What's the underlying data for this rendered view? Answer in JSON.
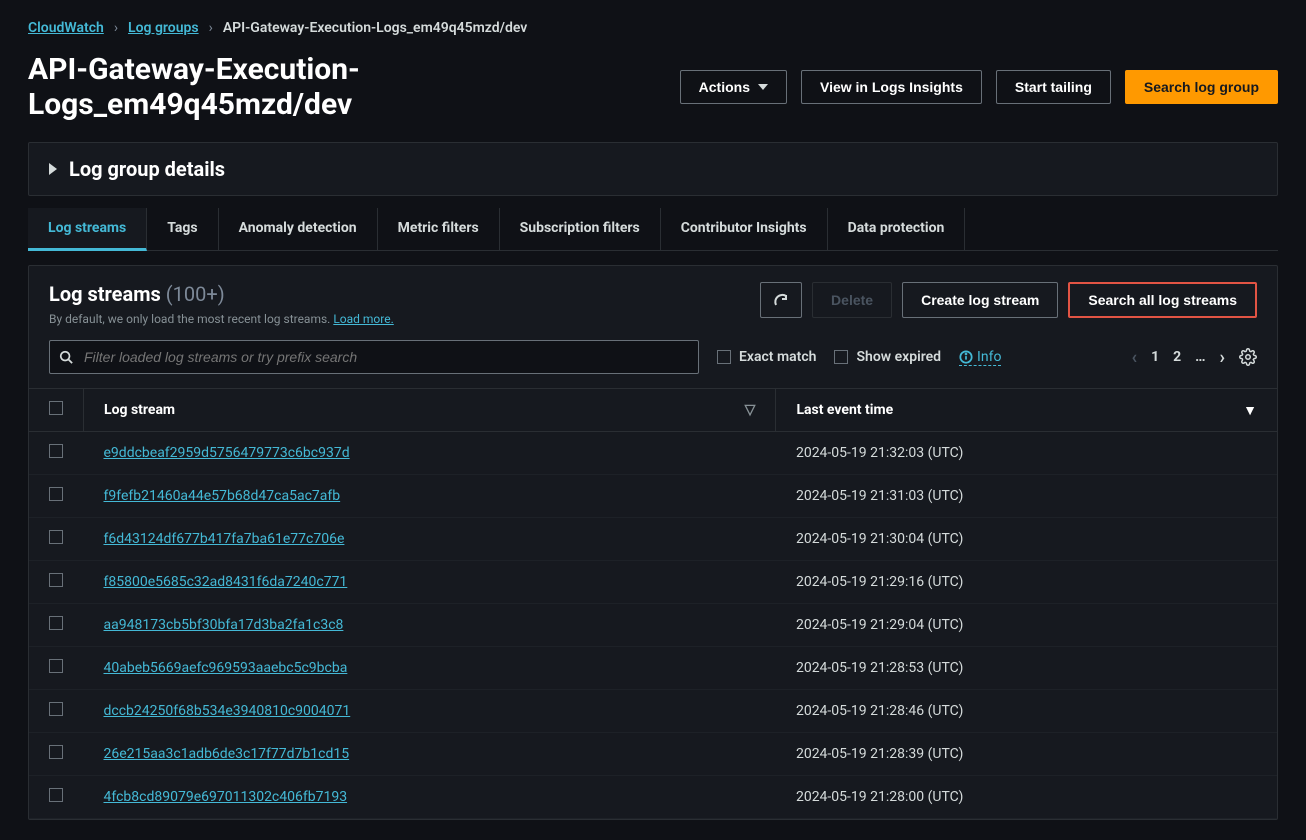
{
  "breadcrumb": {
    "root": "CloudWatch",
    "parent": "Log groups",
    "current": "API-Gateway-Execution-Logs_em49q45mzd/dev"
  },
  "header": {
    "title": "API-Gateway-Execution-Logs_em49q45mzd/dev",
    "actions": "Actions",
    "view_insights": "View in Logs Insights",
    "start_tailing": "Start tailing",
    "search_group": "Search log group"
  },
  "details": {
    "title": "Log group details"
  },
  "tabs": {
    "log_streams": "Log streams",
    "tags": "Tags",
    "anomaly": "Anomaly detection",
    "metric_filters": "Metric filters",
    "subscription_filters": "Subscription filters",
    "contributor": "Contributor Insights",
    "data_protection": "Data protection"
  },
  "streams_panel": {
    "title": "Log streams",
    "count": "(100+)",
    "subtext": "By default, we only load the most recent log streams.",
    "load_more": "Load more.",
    "delete": "Delete",
    "create": "Create log stream",
    "search_all": "Search all log streams"
  },
  "filter": {
    "placeholder": "Filter loaded log streams or try prefix search",
    "exact": "Exact match",
    "expired": "Show expired",
    "info": "Info"
  },
  "pagination": {
    "p1": "1",
    "p2": "2",
    "ell": "…"
  },
  "columns": {
    "stream": "Log stream",
    "time": "Last event time"
  },
  "rows": [
    {
      "name": "e9ddcbeaf2959d5756479773c6bc937d",
      "time": "2024-05-19 21:32:03 (UTC)"
    },
    {
      "name": "f9fefb21460a44e57b68d47ca5ac7afb",
      "time": "2024-05-19 21:31:03 (UTC)"
    },
    {
      "name": "f6d43124df677b417fa7ba61e77c706e",
      "time": "2024-05-19 21:30:04 (UTC)"
    },
    {
      "name": "f85800e5685c32ad8431f6da7240c771",
      "time": "2024-05-19 21:29:16 (UTC)"
    },
    {
      "name": "aa948173cb5bf30bfa17d3ba2fa1c3c8",
      "time": "2024-05-19 21:29:04 (UTC)"
    },
    {
      "name": "40abeb5669aefc969593aaebc5c9bcba",
      "time": "2024-05-19 21:28:53 (UTC)"
    },
    {
      "name": "dccb24250f68b534e3940810c9004071",
      "time": "2024-05-19 21:28:46 (UTC)"
    },
    {
      "name": "26e215aa3c1adb6de3c17f77d7b1cd15",
      "time": "2024-05-19 21:28:39 (UTC)"
    },
    {
      "name": "4fcb8cd89079e697011302c406fb7193",
      "time": "2024-05-19 21:28:00 (UTC)"
    }
  ]
}
